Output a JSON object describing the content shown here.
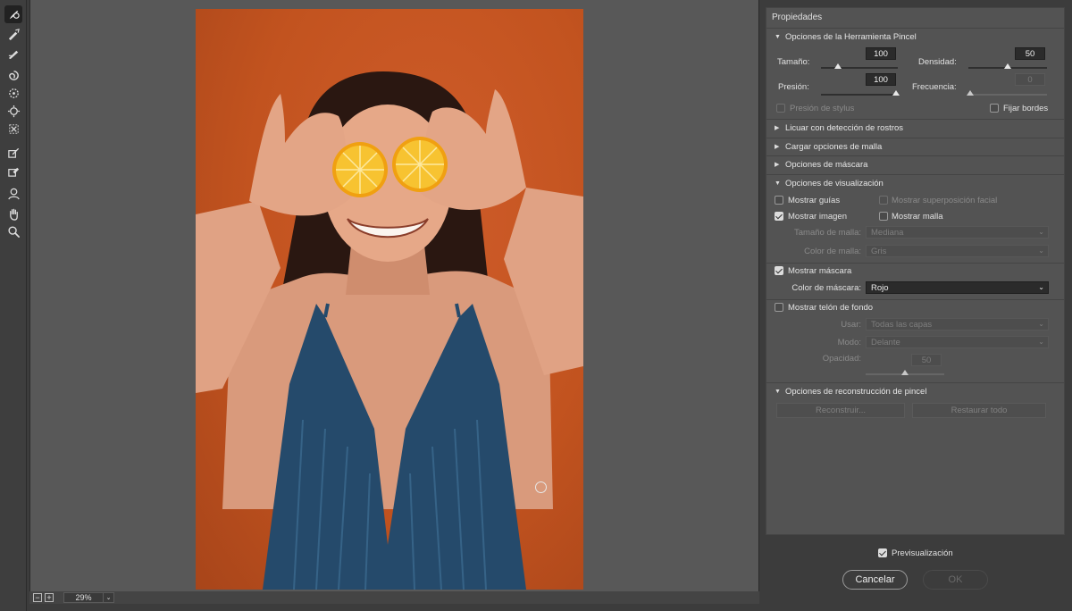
{
  "toolbar": {
    "tools": [
      "forward-warp-icon",
      "reconstruct-icon",
      "smooth-icon",
      "twirl-icon",
      "pucker-icon",
      "bloat-icon",
      "push-left-icon",
      "freeze-mask-icon",
      "thaw-mask-icon",
      "face-tool-icon",
      "hand-icon",
      "zoom-icon"
    ]
  },
  "status": {
    "zoom_minus": "−",
    "zoom_plus": "+",
    "zoom_value": "29%"
  },
  "panel": {
    "title": "Propiedades",
    "brush": {
      "header": "Opciones de la Herramienta Pincel",
      "size_label": "Tamaño:",
      "size_value": "100",
      "density_label": "Densidad:",
      "density_value": "50",
      "pressure_label": "Presión:",
      "pressure_value": "100",
      "rate_label": "Frecuencia:",
      "rate_value": "0",
      "stylus_label": "Presión de stylus",
      "pin_edges_label": "Fijar bordes"
    },
    "sections": {
      "face_aware": "Licuar con detección de rostros",
      "load_mesh": "Cargar opciones de malla",
      "mask_options": "Opciones de máscara",
      "view_options": "Opciones de visualización",
      "reconstruct": "Opciones de reconstrucción de pincel"
    },
    "view": {
      "show_guides": "Mostrar guías",
      "show_face_overlay": "Mostrar superposición facial",
      "show_image": "Mostrar imagen",
      "show_mesh": "Mostrar malla",
      "mesh_size_label": "Tamaño de malla:",
      "mesh_size_value": "Mediana",
      "mesh_color_label": "Color de malla:",
      "mesh_color_value": "Gris",
      "show_mask": "Mostrar máscara",
      "mask_color_label": "Color de máscara:",
      "mask_color_value": "Rojo",
      "show_backdrop": "Mostrar telón de fondo",
      "use_label": "Usar:",
      "use_value": "Todas las capas",
      "mode_label": "Modo:",
      "mode_value": "Delante",
      "opacity_label": "Opacidad:",
      "opacity_value": "50"
    },
    "reconstruct_btn": "Reconstruir...",
    "restore_all_btn": "Restaurar todo"
  },
  "footer": {
    "preview_label": "Previsualización",
    "cancel": "Cancelar",
    "ok": "OK"
  }
}
